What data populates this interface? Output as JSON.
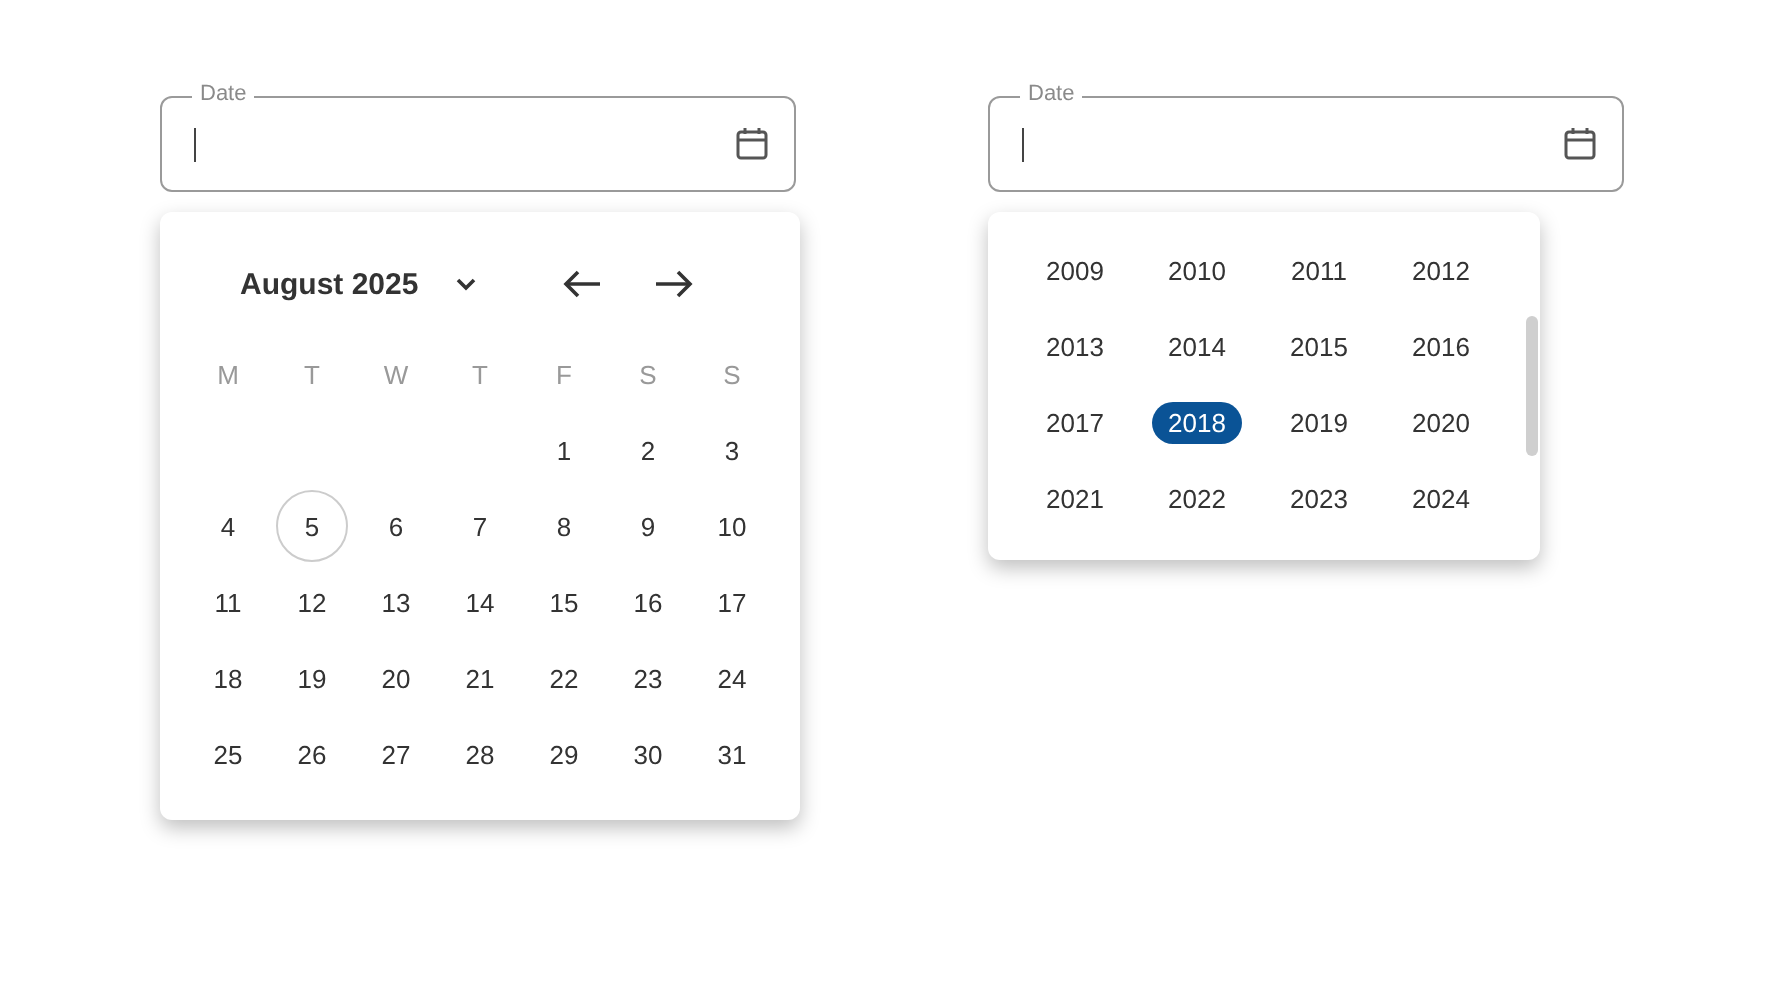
{
  "day_picker": {
    "field": {
      "label": "Date"
    },
    "calendar": {
      "month_label": "August 2025",
      "weekdays": [
        "M",
        "T",
        "W",
        "T",
        "F",
        "S",
        "S"
      ],
      "weeks": [
        [
          {
            "day": "1",
            "today": false
          },
          {
            "day": "2",
            "today": false
          },
          {
            "day": "3",
            "today": false
          }
        ],
        [
          {
            "day": "4",
            "today": false
          },
          {
            "day": "5",
            "today": true
          },
          {
            "day": "6",
            "today": false
          },
          {
            "day": "7",
            "today": false
          },
          {
            "day": "8",
            "today": false
          },
          {
            "day": "9",
            "today": false
          },
          {
            "day": "10",
            "today": false
          }
        ],
        [
          {
            "day": "11",
            "today": false
          },
          {
            "day": "12",
            "today": false
          },
          {
            "day": "13",
            "today": false
          },
          {
            "day": "14",
            "today": false
          },
          {
            "day": "15",
            "today": false
          },
          {
            "day": "16",
            "today": false
          },
          {
            "day": "17",
            "today": false
          }
        ],
        [
          {
            "day": "18",
            "today": false
          },
          {
            "day": "19",
            "today": false
          },
          {
            "day": "20",
            "today": false
          },
          {
            "day": "21",
            "today": false
          },
          {
            "day": "22",
            "today": false
          },
          {
            "day": "23",
            "today": false
          },
          {
            "day": "24",
            "today": false
          }
        ],
        [
          {
            "day": "25",
            "today": false
          },
          {
            "day": "26",
            "today": false
          },
          {
            "day": "27",
            "today": false
          },
          {
            "day": "28",
            "today": false
          },
          {
            "day": "29",
            "today": false
          },
          {
            "day": "30",
            "today": false
          },
          {
            "day": "31",
            "today": false
          }
        ]
      ]
    }
  },
  "year_picker": {
    "field": {
      "label": "Date"
    },
    "years": [
      {
        "label": "2009",
        "selected": false
      },
      {
        "label": "2010",
        "selected": false
      },
      {
        "label": "2011",
        "selected": false
      },
      {
        "label": "2012",
        "selected": false
      },
      {
        "label": "2013",
        "selected": false
      },
      {
        "label": "2014",
        "selected": false
      },
      {
        "label": "2015",
        "selected": false
      },
      {
        "label": "2016",
        "selected": false
      },
      {
        "label": "2017",
        "selected": false
      },
      {
        "label": "2018",
        "selected": true
      },
      {
        "label": "2019",
        "selected": false
      },
      {
        "label": "2020",
        "selected": false
      },
      {
        "label": "2021",
        "selected": false
      },
      {
        "label": "2022",
        "selected": false
      },
      {
        "label": "2023",
        "selected": false
      },
      {
        "label": "2024",
        "selected": false
      }
    ]
  }
}
